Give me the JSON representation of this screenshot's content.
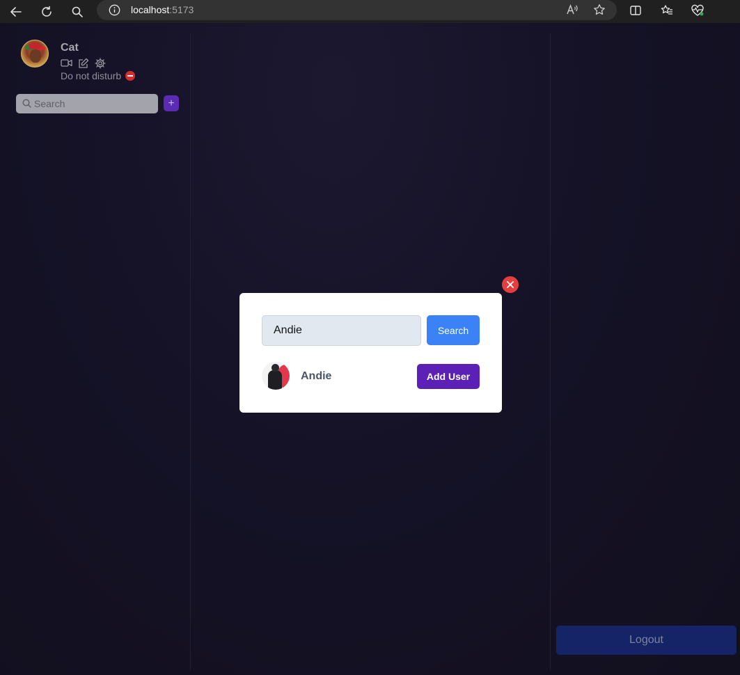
{
  "browser": {
    "url_host": "localhost",
    "url_port": ":5173"
  },
  "user": {
    "name": "Cat",
    "status": "Do not disturb",
    "status_color": "#d32f2f"
  },
  "sidebar": {
    "search_placeholder": "Search",
    "add_label": "+"
  },
  "modal": {
    "search_value": "Andie",
    "search_button": "Search",
    "result": {
      "name": "Andie",
      "add_button": "Add User"
    }
  },
  "footer": {
    "logout_label": "Logout"
  },
  "colors": {
    "accent_purple": "#5b21b6",
    "search_blue": "#3b82f6",
    "close_red": "#e53e3e",
    "logout_navy": "#142466"
  }
}
